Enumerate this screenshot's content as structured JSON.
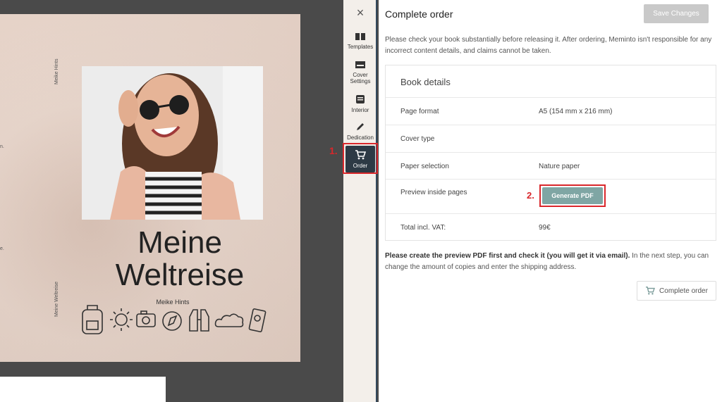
{
  "cover": {
    "spine_author": "Meike Hints",
    "spine_title": "Meine Weltreise",
    "edge_text_1": "n.",
    "edge_text_2": "e.",
    "title_line1": "Meine",
    "title_line2": "Weltreise",
    "author": "Meike Hints"
  },
  "toolbar": {
    "close": "×",
    "items": [
      {
        "label": "Templates"
      },
      {
        "label": "Cover Settings"
      },
      {
        "label": "Interior"
      },
      {
        "label": "Dedication"
      },
      {
        "label": "Order"
      }
    ],
    "step1": "1."
  },
  "panel": {
    "title": "Complete order",
    "save_label": "Save Changes",
    "notice": "Please check your book substantially before releasing it. After ordering, Meminto isn't responsible for any incorrect content details, and claims cannot be taken.",
    "details_title": "Book details",
    "rows": [
      {
        "key": "Page format",
        "value": "A5 (154 mm x 216 mm)"
      },
      {
        "key": "Cover type",
        "value": ""
      },
      {
        "key": "Paper selection",
        "value": "Nature paper"
      },
      {
        "key": "Preview inside pages",
        "value": ""
      },
      {
        "key": "Total incl. VAT:",
        "value": "99€"
      }
    ],
    "generate_label": "Generate PDF",
    "step2": "2.",
    "hint_bold": "Please create the preview PDF first and check it (you will get it via email).",
    "hint_rest": " In the next step, you can change the amount of copies and enter the shipping address.",
    "complete_label": "Complete order"
  },
  "colors": {
    "accent_red": "#d9272b",
    "toolbar_active": "#2d3a45",
    "generate_button": "#7fa6a4"
  }
}
